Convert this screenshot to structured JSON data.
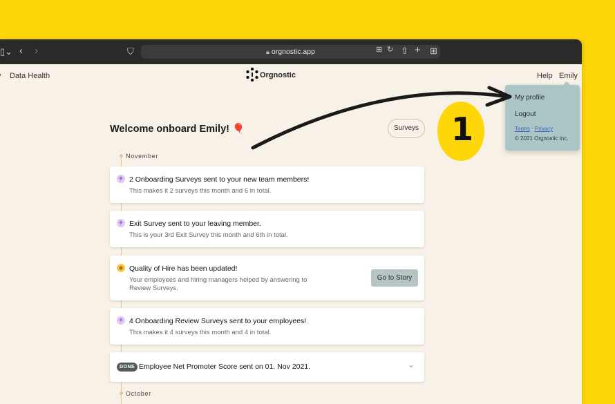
{
  "browser": {
    "url": "orgnostic.app"
  },
  "nav": {
    "left_partial": "y",
    "data_health": "Data Health",
    "logo_text": "Orgnostic",
    "help": "Help",
    "user": "Emily"
  },
  "dropdown": {
    "my_profile": "My profile",
    "logout": "Logout",
    "terms": "Terms",
    "separator": " · ",
    "privacy": "Privacy",
    "copyright": "© 2021 Orgnostic Inc."
  },
  "main": {
    "welcome": "Welcome onboard Emily! 🎈",
    "surveys_button": "Surveys",
    "months": [
      "November",
      "October"
    ]
  },
  "cards": [
    {
      "icon": "paper-plane-icon",
      "title": "2 Onboarding Surveys sent to your new team members!",
      "subtitle": "This makes it 2 surveys this month and 6 in total."
    },
    {
      "icon": "paper-plane-icon",
      "title": "Exit Survey sent to your leaving member.",
      "subtitle": "This is your 3rd Exit Survey this month and 6th in total."
    },
    {
      "icon": "quality-icon",
      "title": "Quality of Hire has been updated!",
      "subtitle": "Your employees and hiring managers helped by answering to Review Surveys.",
      "button": "Go to Story"
    },
    {
      "icon": "paper-plane-icon",
      "title": "4 Onboarding Review Surveys sent to your employees!",
      "subtitle": "This makes it 4 surveys this month and 4 in total."
    },
    {
      "badge": "DONE",
      "title": "Employee Net Promoter Score sent on 01. Nov 2021."
    }
  ],
  "annotation": {
    "step": "1"
  },
  "colors": {
    "background": "#ffd60a",
    "page": "#f8f1e7",
    "dropdown": "#abc6c5",
    "accent_purple": "#c9a4e8"
  }
}
